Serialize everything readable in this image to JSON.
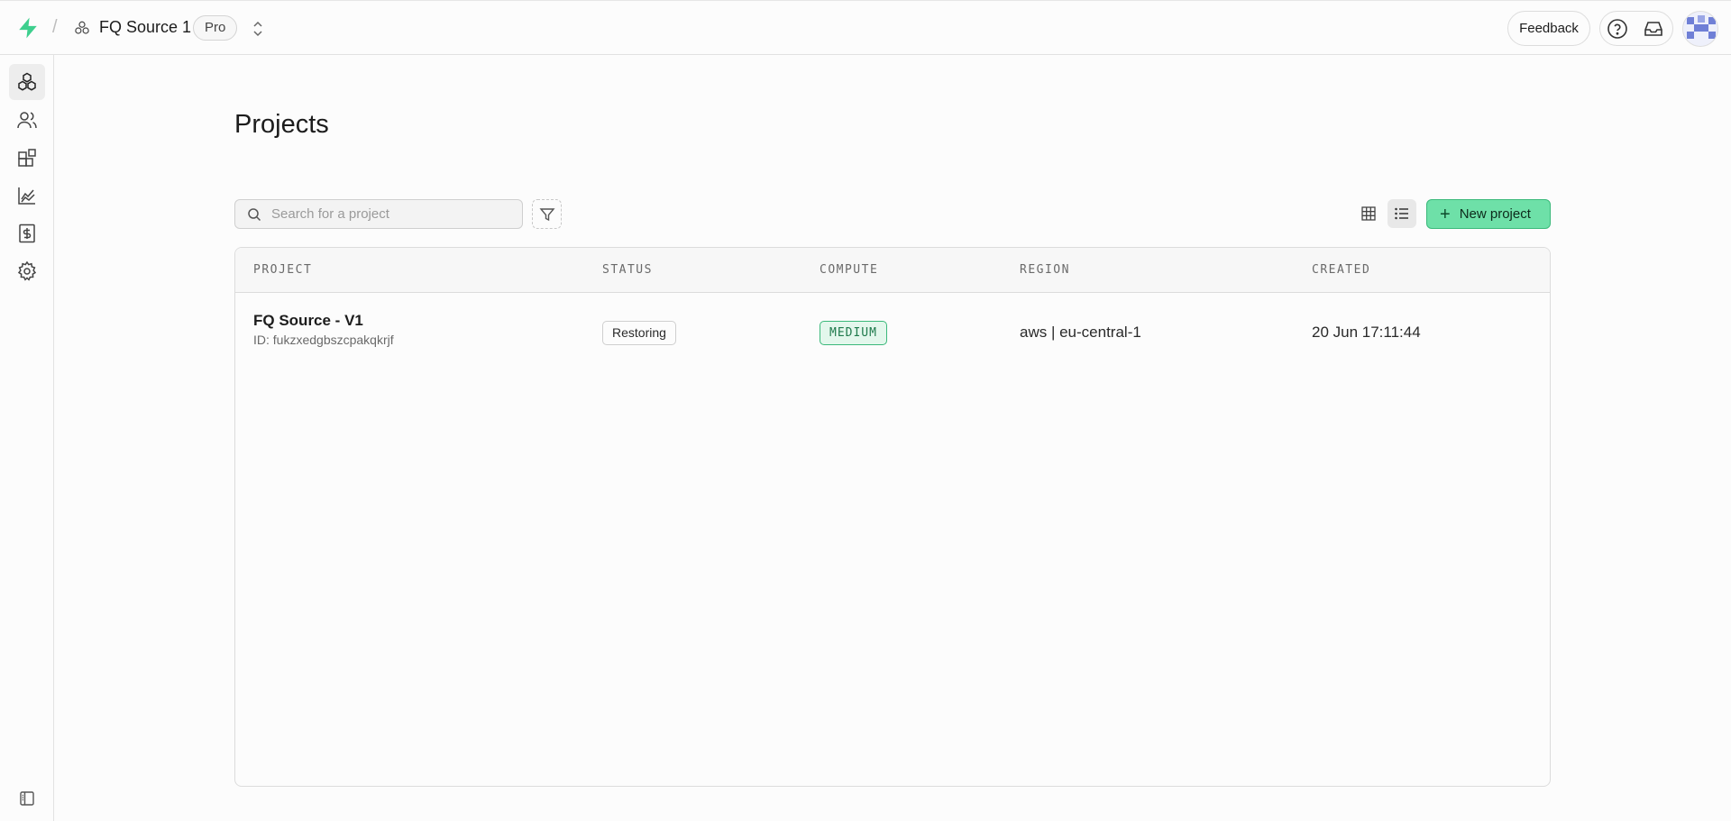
{
  "header": {
    "org_name": "FQ Source 1",
    "plan": "Pro",
    "feedback_label": "Feedback",
    "brand_color": "#3ecf8e"
  },
  "sidebar": {
    "items": [
      {
        "icon": "projects-icon",
        "active": true
      },
      {
        "icon": "team-icon",
        "active": false
      },
      {
        "icon": "integrations-icon",
        "active": false
      },
      {
        "icon": "usage-icon",
        "active": false
      },
      {
        "icon": "billing-icon",
        "active": false
      },
      {
        "icon": "settings-icon",
        "active": false
      }
    ]
  },
  "main": {
    "title": "Projects",
    "search": {
      "placeholder": "Search for a project",
      "value": ""
    },
    "new_project_label": "New project",
    "table": {
      "columns": [
        "PROJECT",
        "STATUS",
        "COMPUTE",
        "REGION",
        "CREATED"
      ],
      "rows": [
        {
          "name": "FQ Source - V1",
          "id": "ID: fukzxedgbszcpakqkrjf",
          "status": "Restoring",
          "compute": "MEDIUM",
          "region": "aws | eu-central-1",
          "created": "20 Jun 17:11:44"
        }
      ]
    }
  },
  "colors": {
    "accent_green": "#6ee0a8",
    "accent_border": "#3bb97b"
  }
}
